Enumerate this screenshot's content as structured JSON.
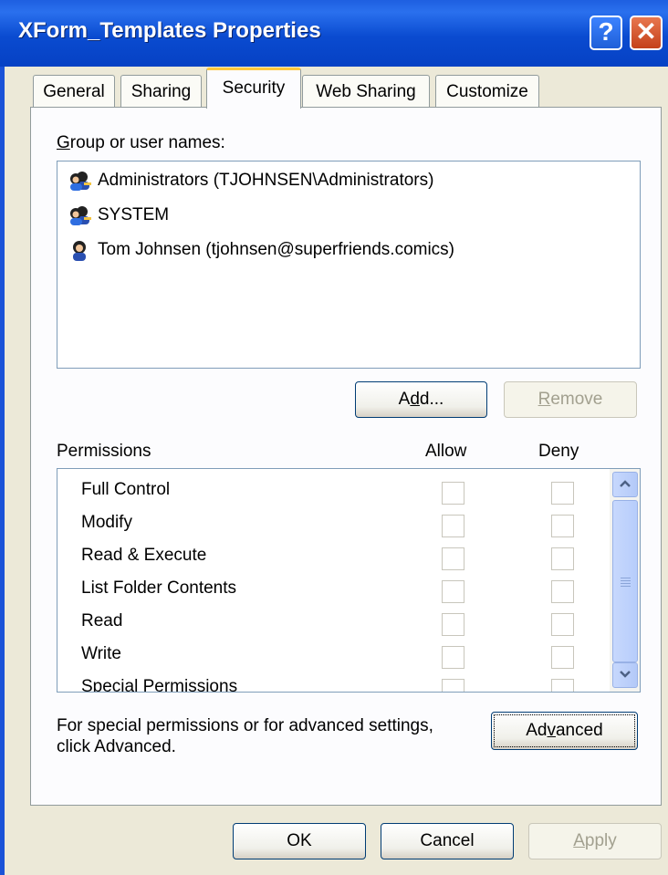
{
  "window": {
    "title": "XForm_Templates Properties",
    "help_label": "?",
    "close_label": "✕"
  },
  "tabs": [
    {
      "label": "General"
    },
    {
      "label": "Sharing"
    },
    {
      "label": "Security"
    },
    {
      "label": "Web Sharing"
    },
    {
      "label": "Customize"
    }
  ],
  "active_tab": "Security",
  "groups": {
    "label_first": "G",
    "label_rest": "roup or user names:",
    "items": [
      {
        "label": "Administrators (TJOHNSEN\\Administrators)",
        "icon": "group-users-icon"
      },
      {
        "label": "SYSTEM",
        "icon": "group-users-icon"
      },
      {
        "label": "Tom Johnsen (tjohnsen@superfriends.comics)",
        "icon": "single-user-icon"
      }
    ]
  },
  "buttons": {
    "add_pre": "A",
    "add_u": "d",
    "add_post": "d...",
    "remove_u": "R",
    "remove_post": "emove",
    "advanced_pre": "Ad",
    "advanced_u": "v",
    "advanced_post": "anced",
    "ok": "OK",
    "cancel": "Cancel",
    "apply_u": "A",
    "apply_post": "pply"
  },
  "permissions": {
    "header": "Permissions",
    "allow_header": "Allow",
    "deny_header": "Deny",
    "rows": [
      {
        "name": "Full Control",
        "allow": false,
        "deny": false
      },
      {
        "name": "Modify",
        "allow": false,
        "deny": false
      },
      {
        "name": "Read & Execute",
        "allow": false,
        "deny": false
      },
      {
        "name": "List Folder Contents",
        "allow": false,
        "deny": false
      },
      {
        "name": "Read",
        "allow": false,
        "deny": false
      },
      {
        "name": "Write",
        "allow": false,
        "deny": false
      },
      {
        "name": "Special Permissions",
        "allow": false,
        "deny": false
      }
    ]
  },
  "advanced_note": {
    "line1": "For special permissions or for advanced settings,",
    "line2": "click Advanced."
  }
}
